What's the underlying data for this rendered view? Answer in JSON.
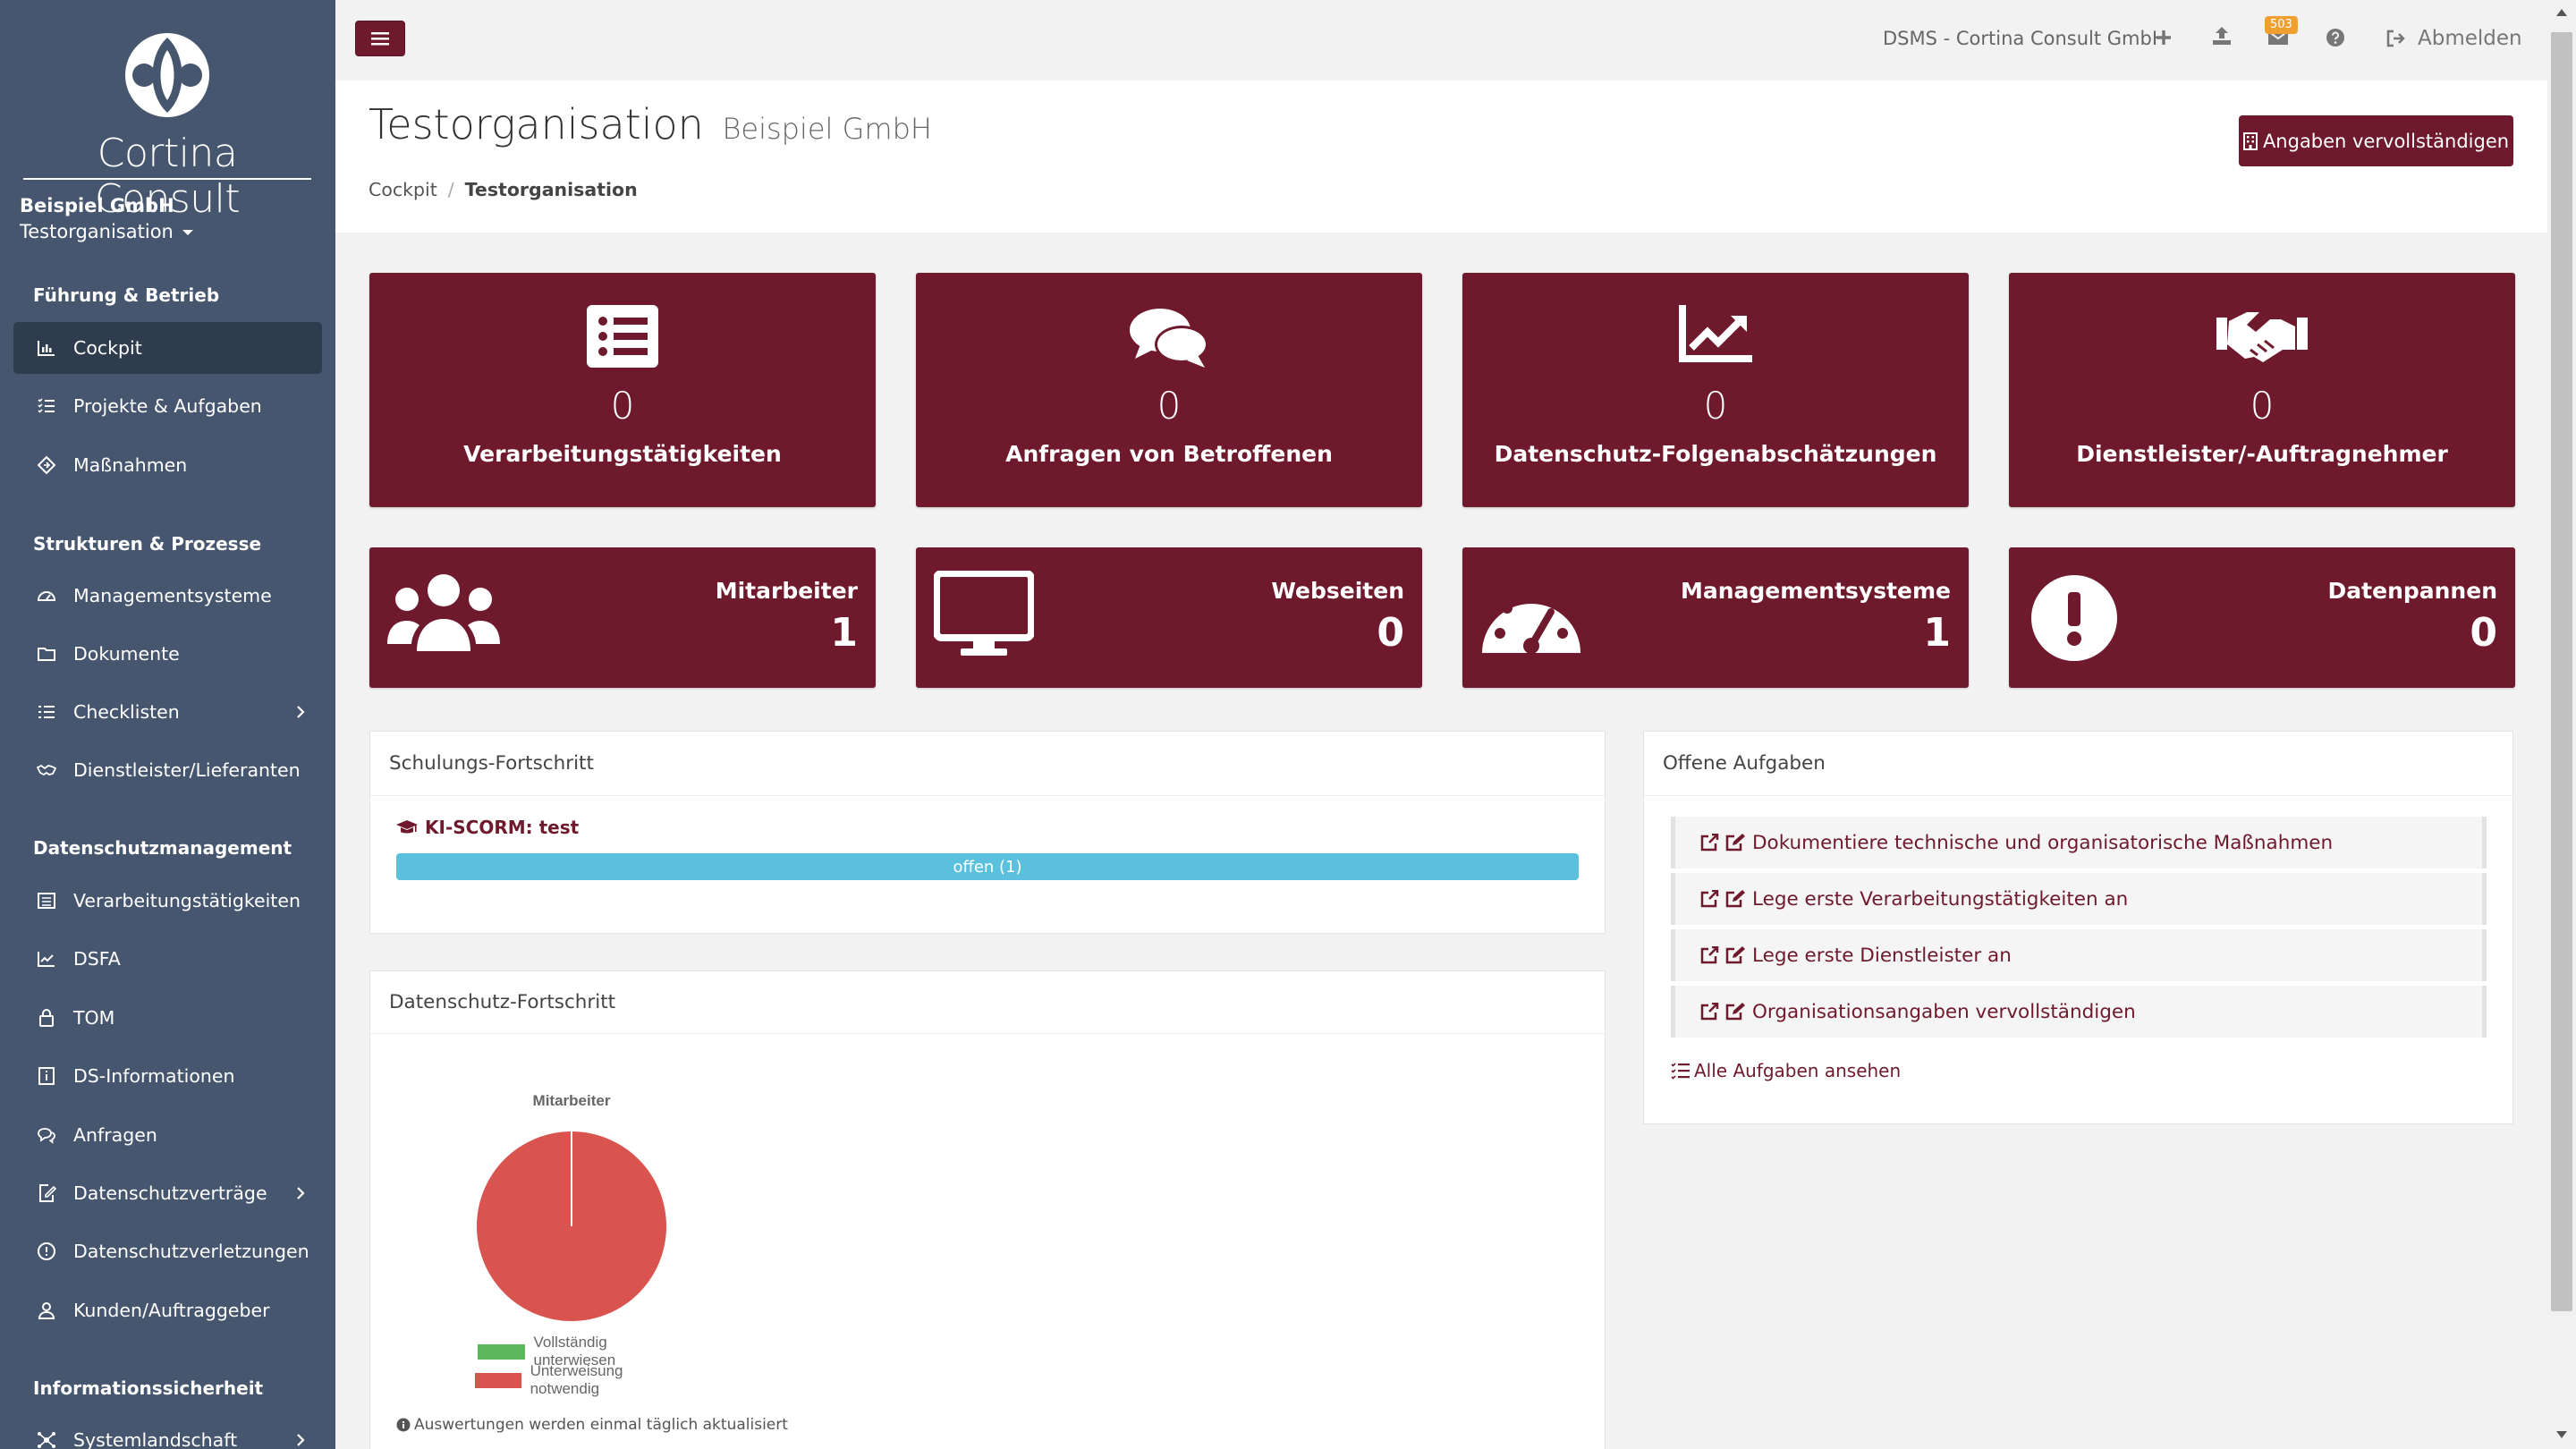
{
  "app": {
    "logo_text": "Cortina Consult",
    "brand_color": "#6e1a2c",
    "sidebar_color": "#46566e"
  },
  "org": {
    "name": "Beispiel GmbH",
    "selected": "Testorganisation"
  },
  "sidebar": {
    "sections": [
      {
        "title": "Führung & Betrieb"
      },
      {
        "title": "Strukturen & Prozesse"
      },
      {
        "title": "Datenschutzmanagement"
      },
      {
        "title": "Informationssicherheit"
      }
    ],
    "items": [
      {
        "label": "Cockpit",
        "icon": "chart-bar-icon",
        "active": true
      },
      {
        "label": "Projekte & Aufgaben",
        "icon": "tasks-icon"
      },
      {
        "label": "Maßnahmen",
        "icon": "diamond-icon"
      },
      {
        "label": "Managementsysteme",
        "icon": "tachometer-icon"
      },
      {
        "label": "Dokumente",
        "icon": "folder-icon"
      },
      {
        "label": "Checklisten",
        "icon": "list-icon",
        "has_children": true
      },
      {
        "label": "Dienstleister/Lieferanten",
        "icon": "handshake-icon"
      },
      {
        "label": "Verarbeitungstätigkeiten",
        "icon": "table-list-icon"
      },
      {
        "label": "DSFA",
        "icon": "chart-line-icon"
      },
      {
        "label": "TOM",
        "icon": "lock-icon"
      },
      {
        "label": "DS-Informationen",
        "icon": "info-box-icon"
      },
      {
        "label": "Anfragen",
        "icon": "comments-icon"
      },
      {
        "label": "Datenschutzverträge",
        "icon": "file-signature-icon",
        "has_children": true
      },
      {
        "label": "Datenschutzverletzungen",
        "icon": "exclamation-circle-icon"
      },
      {
        "label": "Kunden/Auftraggeber",
        "icon": "user-tie-icon"
      },
      {
        "label": "Systemlandschaft",
        "icon": "network-icon",
        "has_children": true
      }
    ]
  },
  "topbar": {
    "org_label": "DSMS - Cortina Consult GmbH",
    "notification_count": "503",
    "logout_label": "Abmelden"
  },
  "page": {
    "title": "Testorganisation",
    "subtitle": "Beispiel GmbH",
    "complete_button": "Angaben vervollständigen",
    "breadcrumb": [
      "Cockpit",
      "Testorganisation"
    ]
  },
  "tiles_big": [
    {
      "value": "0",
      "label": "Verarbeitungstätigkeiten",
      "icon": "list-alt-icon"
    },
    {
      "value": "0",
      "label": "Anfragen von Betroffenen",
      "icon": "comments-icon"
    },
    {
      "value": "0",
      "label": "Datenschutz-Folgenabschätzungen",
      "icon": "chart-area-icon"
    },
    {
      "value": "0",
      "label": "Dienstleister/-Auftragnehmer",
      "icon": "handshake-icon"
    }
  ],
  "tiles_small": [
    {
      "label": "Mitarbeiter",
      "value": "1",
      "icon": "users-icon"
    },
    {
      "label": "Webseiten",
      "value": "0",
      "icon": "desktop-icon"
    },
    {
      "label": "Managementsysteme",
      "value": "1",
      "icon": "tachometer-icon"
    },
    {
      "label": "Datenpannen",
      "value": "0",
      "icon": "exclamation-circle-icon"
    }
  ],
  "training": {
    "title": "Schulungs-Fortschritt",
    "course": "KI-SCORM: test",
    "status": "offen (1)",
    "progress": 1.0,
    "bar_color": "#5bc0de"
  },
  "privacy": {
    "title": "Datenschutz-Fortschritt",
    "note": "Auswertungen werden einmal täglich aktualisiert"
  },
  "tasks": {
    "title": "Offene Aufgaben",
    "items": [
      "Dokumentiere technische und organisatorische Maßnahmen",
      "Lege erste Verarbeitungstätigkeiten an",
      "Lege erste Dienstleister an",
      "Organisationsangaben vervollständigen"
    ],
    "all_label": "Alle Aufgaben ansehen"
  },
  "chart_data": {
    "type": "pie",
    "title": "Mitarbeiter",
    "categories": [
      "Vollständig unterwiesen",
      "Unterweisung notwendig"
    ],
    "values": [
      0,
      1
    ],
    "colors": [
      "#5cb85c",
      "#d9534f"
    ],
    "legend": "bottom"
  }
}
